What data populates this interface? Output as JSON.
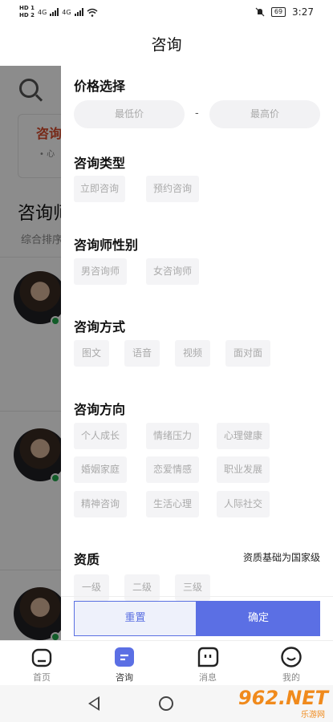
{
  "status_bar": {
    "hd1": "HD 1",
    "hd2": "HD 2",
    "net1": "4G",
    "net2": "4G",
    "battery": "69",
    "time": "3:27"
  },
  "nav": {
    "title": "咨询"
  },
  "background_page": {
    "card_title": "咨询",
    "card_sub": "• 心",
    "heading": "咨询师",
    "sort": "综合排序"
  },
  "filter": {
    "price": {
      "title": "价格选择",
      "min_placeholder": "最低价",
      "dash": "-",
      "max_placeholder": "最高价"
    },
    "type": {
      "title": "咨询类型",
      "options": [
        "立即咨询",
        "预约咨询"
      ]
    },
    "gender": {
      "title": "咨询师性别",
      "options": [
        "男咨询师",
        "女咨询师"
      ]
    },
    "method": {
      "title": "咨询方式",
      "options": [
        "图文",
        "语音",
        "视频",
        "面对面"
      ]
    },
    "direction": {
      "title": "咨询方向",
      "options": [
        "个人成长",
        "情绪压力",
        "心理健康",
        "婚姻家庭",
        "恋爱情感",
        "职业发展",
        "精神咨询",
        "生活心理",
        "人际社交"
      ]
    },
    "qualification": {
      "title": "资质",
      "note": "资质基础为国家级",
      "options": [
        "一级",
        "二级",
        "三级"
      ]
    },
    "reset_label": "重置",
    "confirm_label": "确定"
  },
  "tabbar": {
    "items": [
      {
        "label": "首页",
        "icon": "home-icon"
      },
      {
        "label": "咨询",
        "icon": "consult-icon"
      },
      {
        "label": "消息",
        "icon": "message-icon"
      },
      {
        "label": "我的",
        "icon": "profile-icon"
      }
    ]
  },
  "watermark": {
    "main": "962.NET",
    "sub": "乐游网"
  },
  "colors": {
    "accent": "#5b6fe4",
    "online": "#1fa84a",
    "highlight": "#d84a2a"
  }
}
